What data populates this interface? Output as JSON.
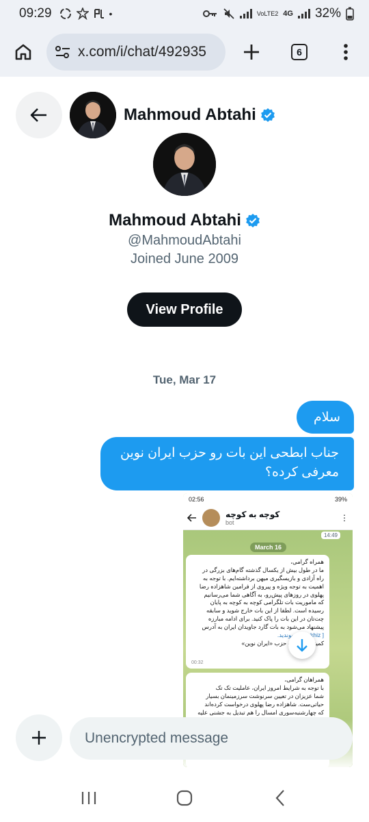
{
  "status_bar": {
    "time": "09:29",
    "network": "4G",
    "carrier_tag": "VoLTE2",
    "battery": "32%"
  },
  "browser": {
    "url": "x.com/i/chat/492935",
    "tab_count": "6"
  },
  "chat_header": {
    "name": "Mahmoud Abtahi"
  },
  "profile": {
    "name": "Mahmoud Abtahi",
    "handle": "@MahmoudAbtahi",
    "joined": "Joined June 2009",
    "view_profile_label": "View Profile"
  },
  "conversation": {
    "date_separator": "Tue, Mar 17",
    "messages": [
      {
        "text": "سلام"
      },
      {
        "text": "جناب ابطحی این بات رو حزب ایران نوین معرفی کرده؟"
      }
    ]
  },
  "attachment": {
    "status_time": "02:56",
    "status_battery": "39%",
    "chat_title": "کوچه به کوچه",
    "chat_subtitle": "bot",
    "first_time": "14:49",
    "date_pill": "March 16",
    "message1_lines": [
      "همراه گرامی،",
      "ما در طول بیش از یکسال گذشته گام‌های بزرگی در",
      "راه آزادی و بازیسگیری میهن برداشته‌ایم. با توجه به",
      "اهمیت به توجه ویژه و پیروی از فرامین شاهزاده رضا",
      "پهلوی در روزهای پیش‌رو، به آگاهی شما می‌رسانیم",
      "که ماموریت بات تلگرامی کوچه به کوچه به پایان",
      "رسیده است. لطفا از این بات خارج شوید و سابقه",
      "چت‌تان در این بات را پاک کنید. برای ادامه مبارزه",
      "پیشنهاد می‌شود به بات گارد جاویدان ایران به آدرس",
      "[ Barkhiz ] بپیوندید.",
      "کمیته ارتباطات حزب «ایران نوین»"
    ],
    "message1_time": "00:32",
    "message2_lines": [
      "همراهان گرامی،",
      "با توجه به شرایط امروز ایران، عاملیت تک تک",
      "شما عزیزان در تعیین سرنوشت سرزمینمان بسیار",
      "حیاتی‌ست. شاهزاده رضا پهلوی درخواست کرده‌اند",
      "که چهارشنبه‌سوری امسال را هم تبدیل به جشنی علیه"
    ]
  },
  "composer": {
    "placeholder": "Unencrypted message"
  },
  "icons": {
    "home": "home-icon",
    "back": "arrow-left-icon",
    "add": "plus-icon",
    "verified": "verified-badge-icon",
    "scroll_down": "arrow-down-icon"
  },
  "colors": {
    "accent": "#1d9bf0",
    "button_dark": "#0f1419",
    "muted_text": "#536471"
  }
}
